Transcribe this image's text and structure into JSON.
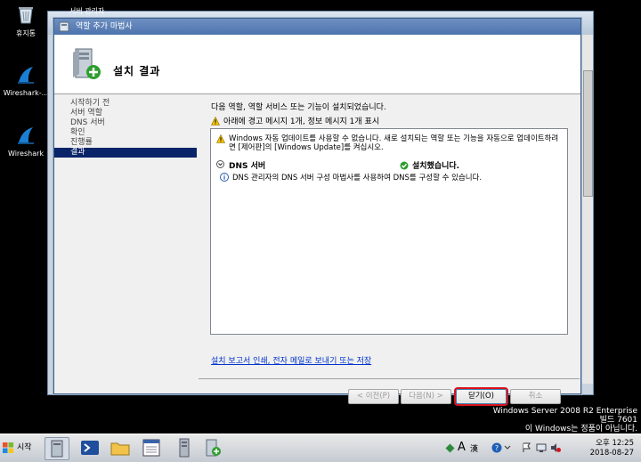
{
  "desktop": {
    "icons": [
      {
        "label": "휴지통"
      },
      {
        "label": "Wireshark-..."
      },
      {
        "label": "Wireshark"
      }
    ],
    "server_info": {
      "line1": "Windows Server 2008 R2 Enterprise",
      "line2": "빌드 7601",
      "line3": "이 Windows는 정품이 아닙니다."
    }
  },
  "background_window": {
    "title": "서버 관리자"
  },
  "dialog": {
    "title": "역할 추가 마법사",
    "header_title": "설치 결과",
    "nav": [
      "시작하기 전",
      "서버 역할",
      "DNS 서버",
      "확인",
      "진행률",
      "결과"
    ],
    "active_nav_index": 5,
    "intro": "다음 역할, 역할 서비스 또는 기능이 설치되었습니다.",
    "summary": "아래에 경고 메시지 1개, 정보 메시지 1개 표시",
    "warning": "Windows 자동 업데이트를 사용할 수 없습니다. 새로 설치되는 역할 또는 기능을 자동으로 업데이트하려면 [제어판]의 [Windows Update]를 켜십시오.",
    "role": {
      "name": "DNS 서버",
      "status": "설치했습니다."
    },
    "info": "DNS 관리자의 DNS 서버 구성 마법사를 사용하여 DNS를 구성할 수 있습니다.",
    "link": "설치 보고서 인쇄, 전자 메일로 보내기 또는 저장",
    "buttons": {
      "prev": "< 이전(P)",
      "next": "다음(N) >",
      "close": "닫기(O)",
      "cancel": "취소"
    }
  },
  "taskbar": {
    "start": "시작",
    "ime_letter": "A",
    "ime_hanja": "漢",
    "clock_time": "오후 12:25",
    "clock_date": "2018-08-27"
  },
  "colors": {
    "accent": "#0a246a",
    "close_highlight": "#d9111b",
    "link": "#0033cc"
  }
}
